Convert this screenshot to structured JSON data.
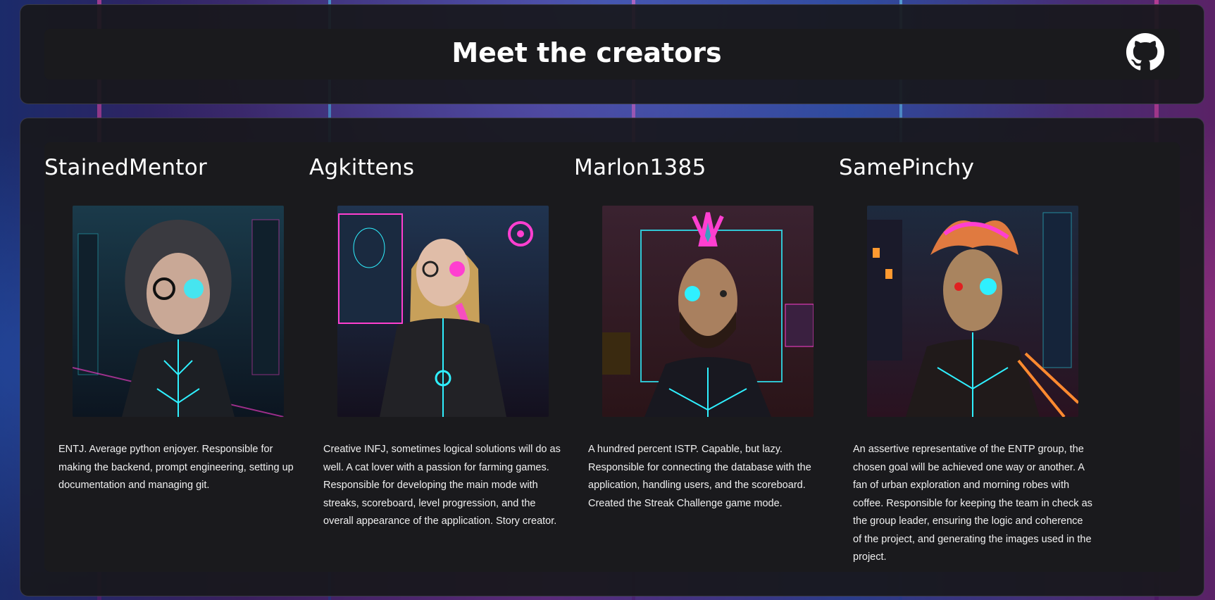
{
  "header": {
    "title": "Meet the creators",
    "github_icon": "github-icon"
  },
  "creators": [
    {
      "name": "StainedMentor",
      "avatar_icon": "portrait-image",
      "bio": "ENTJ. Average python enjoyer. Responsible for making the backend, prompt engineering, setting up documentation and managing git."
    },
    {
      "name": "Agkittens",
      "avatar_icon": "portrait-image",
      "bio": "Creative INFJ, sometimes logical solutions will do as well. A cat lover with a passion for farming games. Responsible for developing the main mode with streaks, scoreboard, level progression, and the overall appearance of the application. Story creator."
    },
    {
      "name": "Marlon1385",
      "avatar_icon": "portrait-image",
      "bio": "A hundred percent ISTP. Capable, but lazy. Responsible for connecting the database with the application, handling users, and the scoreboard. Created the Streak Challenge game mode."
    },
    {
      "name": "SamePinchy",
      "avatar_icon": "portrait-image",
      "bio": "An assertive representative of the ENTP group, the chosen goal will be achieved one way or another. A fan of urban exploration and morning robes with coffee. Responsible for keeping the team in check as the group leader, ensuring the logic and coherence of the project, and generating the images used in the project."
    }
  ],
  "colors": {
    "panel": "#18181c",
    "accent_cyan": "#2ff0ff",
    "accent_magenta": "#ff3fd0",
    "text": "#ffffff"
  }
}
